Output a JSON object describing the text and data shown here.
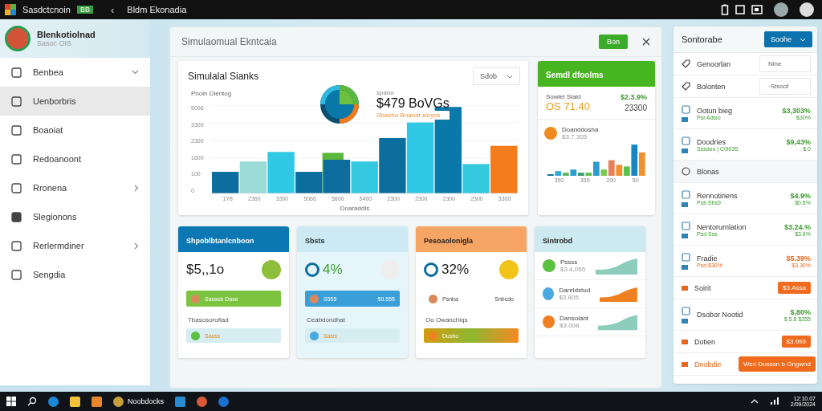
{
  "top_bar": {
    "app_title": "Sasdctcnoin",
    "badge": "BB",
    "back": "‹",
    "page_title": "Bldm Ekonadia"
  },
  "sidebar": {
    "profile": {
      "name": "Blenkotiolnad",
      "subtitle": "Sasoc OIS"
    },
    "items": [
      {
        "label": "Benbea",
        "kind": "dropdown",
        "selected": false
      },
      {
        "label": "Uenborbris",
        "kind": "plain",
        "selected": true
      },
      {
        "label": "Boaoiat",
        "kind": "plain",
        "selected": false
      },
      {
        "label": "Redoanoont",
        "kind": "plain",
        "selected": false
      },
      {
        "label": "Rronena",
        "kind": "submenu",
        "selected": false
      },
      {
        "label": "Slegionons",
        "kind": "plain",
        "selected": false
      },
      {
        "label": "Rerlermdiner",
        "kind": "submenu",
        "selected": false
      },
      {
        "label": "Sengdia",
        "kind": "plain",
        "selected": false
      }
    ]
  },
  "main": {
    "title": "Simulaomual Ekntcaia",
    "button": "Bon",
    "chart_card": {
      "title": "Simulalal Sianks",
      "dropdown": "Sdob",
      "chart_label": "Pnoin Dlentog",
      "y_labels": [
        "5006",
        "3300",
        "2300",
        "1600",
        "100",
        "0"
      ],
      "x_labels": [
        "1Y8",
        "2360",
        "3300",
        "5066",
        "5800",
        "5400",
        "2300",
        "2300",
        "2300",
        "2300",
        "3300"
      ],
      "x_caption": "Doaraddls",
      "kicker": "spano",
      "amount": "$479 BoVGs",
      "amount_note": "Sbasbo Bnanat sloyns"
    },
    "green_card": {
      "title": "Semdl dfoolms",
      "label": "Sowiel Slaid",
      "value": "OS 71.40",
      "change": "$2.3.9%",
      "count": "23300",
      "sub_title": "Doanddosha",
      "sub_value": "$3.7.305",
      "x_labels": [
        "350",
        "355",
        "200",
        "50"
      ]
    },
    "cards": [
      {
        "kind": "blue",
        "title": "Shpoblbtanlcnboon",
        "value": "$5,,1o",
        "pill": "Sasasb Dase",
        "label": "Tbasosoroflad",
        "pill2": "Sasss"
      },
      {
        "kind": "light",
        "title": "Sbsts",
        "value": "4%",
        "pill": "S555",
        "pill_value": "$9.555",
        "label": "Ceabdondhat",
        "pill2": "Sasis"
      },
      {
        "kind": "orange",
        "title": "Pesoaolonigla",
        "value": "32%",
        "pill": "Psnba",
        "pill_value": "Snbcdo",
        "label": "Oo Owanchiqs",
        "pill2": "Dusbo"
      }
    ],
    "trend_card": {
      "title": "Sintrobd",
      "rows": [
        {
          "label": "Pssss",
          "value": "$3.4,055"
        },
        {
          "label": "Danrldstud",
          "value": "$3.805"
        },
        {
          "label": "Dansolant",
          "value": "$3.008"
        }
      ]
    }
  },
  "right_panel": {
    "title": "Sontorabe",
    "button": "Soohe",
    "rows": [
      {
        "kind": "select",
        "label": "Genoorlan",
        "value": "Nlne"
      },
      {
        "kind": "select",
        "label": "Bolonten",
        "value": "·Stsoof"
      },
      {
        "kind": "metric",
        "label": "Ootun bieg",
        "sub": "Psr Adsio",
        "value": "$3,303%",
        "sub_value": "$30%",
        "color": "#3a9a2c"
      },
      {
        "kind": "metric",
        "label": "Doodries",
        "sub": "Sssdoo | C0l03S",
        "value": "$9,43%",
        "sub_value": "$ 0",
        "color": "#3a9a2c"
      },
      {
        "kind": "section",
        "label": "Blonas"
      },
      {
        "kind": "metric",
        "label": "Rennotiriens",
        "sub": "Psb Sbs9",
        "value": "$4.9%",
        "sub_value": "$0.5%",
        "color": "#3a9a2c"
      },
      {
        "kind": "metric",
        "label": "Nentorurnlation",
        "sub": "Psd Sss",
        "value": "$3.24.%",
        "sub_value": "$3.6%",
        "color": "#3a9a2c"
      },
      {
        "kind": "metric",
        "label": "Fradie",
        "sub": "Psd $30%",
        "value": "$5.39%",
        "sub_value": "$3.30%",
        "color": "#e8661c"
      },
      {
        "kind": "badge",
        "label": "Soirit",
        "value": "$3.Assa"
      },
      {
        "kind": "metric",
        "label": "Dsobor Nootid",
        "value": "$,80%",
        "sub_value": "$ 5.8 $355",
        "color": "#3a9a2c"
      },
      {
        "kind": "badge",
        "label": "Dotien",
        "value": "$3.999"
      },
      {
        "kind": "action",
        "label": "Dnobdie",
        "value": "Wsn Dusson b Gngwnd"
      }
    ]
  },
  "taskbar": {
    "app": "Noobdocks",
    "time": "12:10.07",
    "date": "2/09/2024"
  }
}
